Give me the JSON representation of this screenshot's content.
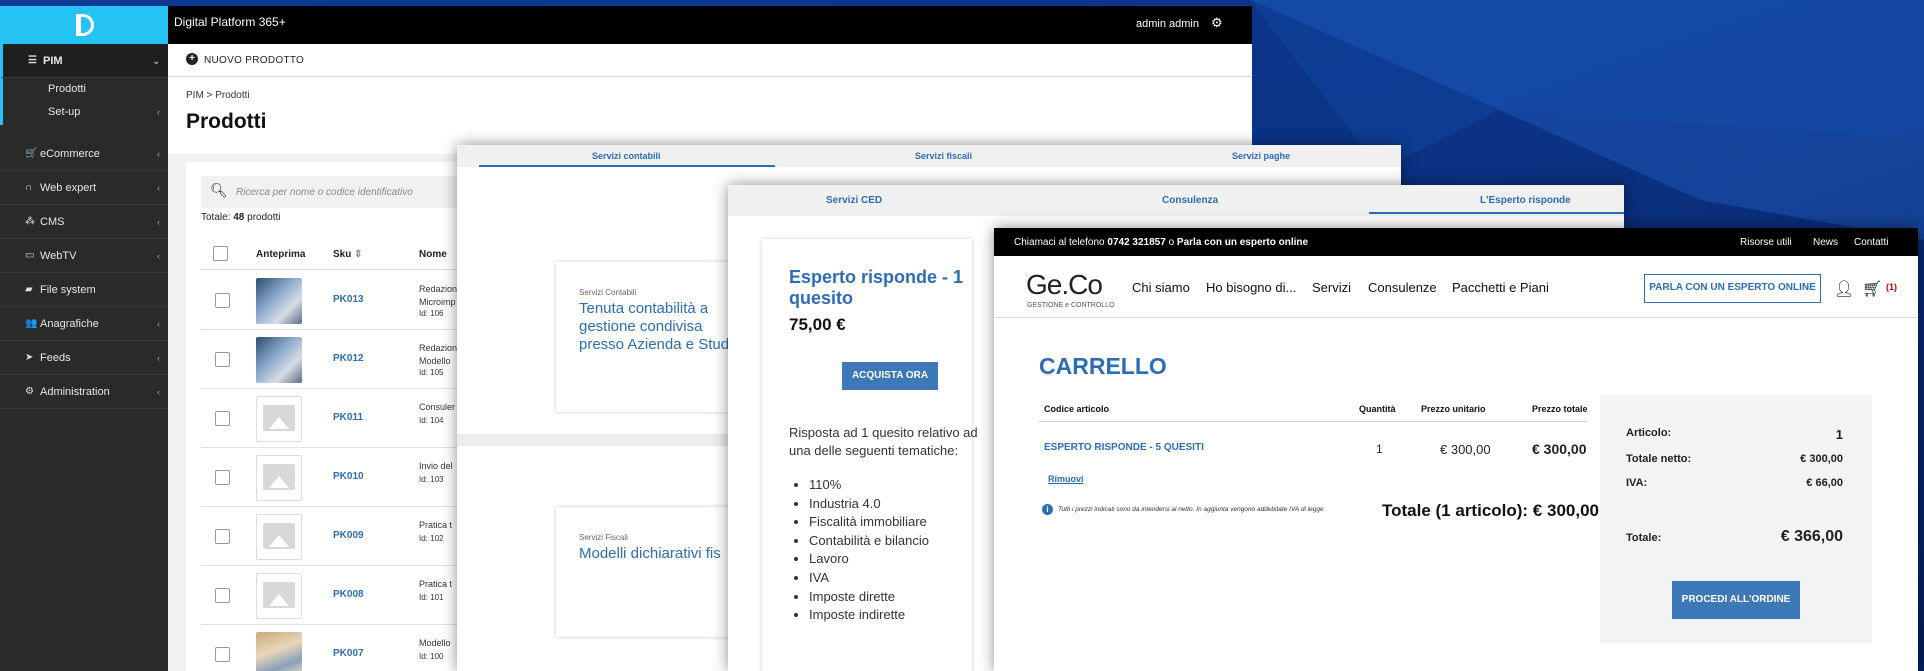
{
  "colors": {
    "background": "#0a2f7e",
    "accent_cyan": "#24c3f4",
    "link_blue": "#2d6db5",
    "button_blue": "#3d78b8"
  },
  "admin": {
    "app_title": "Digital Platform 365+",
    "user_name": "admin admin",
    "sidebar": {
      "pim": "PIM",
      "pim_sub": [
        "Prodotti",
        "Set-up"
      ],
      "items": [
        "eCommerce",
        "Web expert",
        "CMS",
        "WebTV",
        "File system",
        "Anagrafiche",
        "Feeds",
        "Administration"
      ]
    },
    "new_product": "NUOVO PRODOTTO",
    "breadcrumb": "PIM > Prodotti",
    "page_title": "Prodotti",
    "search_placeholder": "Ricerca per nome o codice identificativo",
    "total_label": "Totale:",
    "total_count": "48",
    "total_suffix": "prodotti",
    "columns": {
      "preview": "Anteprima",
      "sku": "Sku",
      "name": "Nome"
    },
    "rows": [
      {
        "sku": "PK013",
        "line1": "Redazion",
        "line2": "Microimp",
        "id": "Id: 106"
      },
      {
        "sku": "PK012",
        "line1": "Redazion",
        "line2": "Modello",
        "id": "Id: 105"
      },
      {
        "sku": "PK011",
        "line1": "Consuler",
        "line2": "",
        "id": "Id: 104"
      },
      {
        "sku": "PK010",
        "line1": "Invio del",
        "line2": "",
        "id": "Id: 103"
      },
      {
        "sku": "PK009",
        "line1": "Pratica t",
        "line2": "",
        "id": "Id: 102"
      },
      {
        "sku": "PK008",
        "line1": "Pratica t",
        "line2": "",
        "id": "Id: 101"
      },
      {
        "sku": "PK007",
        "line1": "Modello",
        "line2": "",
        "id": "Id: 100"
      }
    ]
  },
  "services": {
    "tabs": [
      "Servizi contabili",
      "Servizi fiscali",
      "Servizi paghe"
    ],
    "cards": [
      {
        "category": "Servizi Contabili",
        "title": [
          "Tenuta contabilità a",
          "gestione condivisa",
          "presso Azienda e Stud"
        ]
      },
      {
        "category": "Servizi Fiscali",
        "title": [
          "Modelli dichiarativi fis"
        ]
      }
    ]
  },
  "esperto": {
    "tabs": [
      "Servizi CED",
      "Consulenza",
      "L'Esperto risponde"
    ],
    "title": "Esperto risponde - 1 quesito",
    "price": "75,00 €",
    "buy": "ACQUISTA ORA",
    "description": "Risposta ad 1 quesito relativo ad una delle seguenti tematiche:",
    "topics": [
      "110%",
      "Industria 4.0",
      "Fiscalità immobiliare",
      "Contabilità e bilancio",
      "Lavoro",
      "IVA",
      "Imposte dirette",
      "Imposte indirette"
    ]
  },
  "cart": {
    "topbar": {
      "call": "Chiamaci al telefono",
      "phone": "0742 321857",
      "or": "o",
      "expert": "Parla con un esperto online",
      "links": [
        "Risorse utili",
        "News",
        "Contatti"
      ]
    },
    "brand": "Ge.Co",
    "brand_sub": "GESTIONE e CONTROLLO",
    "menu": [
      "Chi siamo",
      "Ho bisogno di...",
      "Servizi",
      "Consulenze",
      "Pacchetti e Piani"
    ],
    "cta": "PARLA CON UN ESPERTO ONLINE",
    "cart_count": "(1)",
    "heading": "CARRELLO",
    "columns": {
      "code": "Codice articolo",
      "qty": "Quantità",
      "unit": "Prezzo unitario",
      "total": "Prezzo totale"
    },
    "item": {
      "name": "ESPERTO RISPONDE - 5 QUESITI",
      "qty": "1",
      "unit": "€ 300,00",
      "total": "€ 300,00"
    },
    "remove": "Rimuovi",
    "note": "Tutti i prezzi indicati sono da intendersi al netto. In aggiunta vengono addebitate IVA di legge",
    "grand_total": "Totale (1 articolo): € 300,00",
    "summary": {
      "articolo_label": "Articolo:",
      "articolo": "1",
      "netto_label": "Totale netto:",
      "netto": "€ 300,00",
      "iva_label": "IVA:",
      "iva": "€ 66,00",
      "totale_label": "Totale:",
      "totale": "€ 366,00"
    },
    "proceed": "PROCEDI ALL'ORDINE"
  }
}
